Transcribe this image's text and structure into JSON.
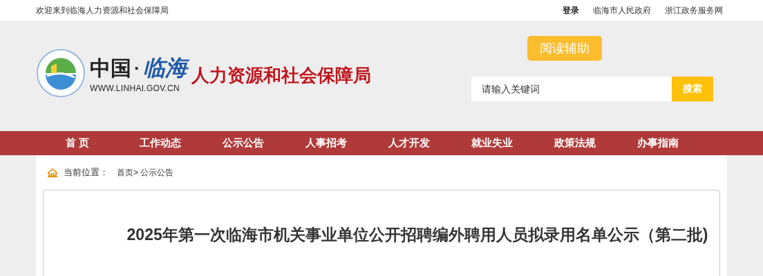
{
  "top_bar": {
    "welcome": "欢迎来到临海人力资源和社会保障局",
    "links": [
      "登录",
      "临海市人民政府",
      "浙江政务服务网"
    ]
  },
  "header": {
    "logo": {
      "china": "中国",
      "dot": "·",
      "linhai": "临海",
      "url": "WWW.LINHAI.GOV.CN",
      "bureau": "人力资源和社会保障局"
    },
    "reading_aid": "阅读辅助",
    "search": {
      "placeholder": "请输入关键词",
      "button": "搜索"
    }
  },
  "nav": [
    "首 页",
    "工作动态",
    "公示公告",
    "人事招考",
    "人才开发",
    "就业失业",
    "政策法规",
    "办事指南"
  ],
  "breadcrumb": {
    "label": "当前位置：",
    "path": "首页> 公示公告"
  },
  "article": {
    "title": "2025年第一次临海市机关事业单位公开招聘编外聘用人员拟录用名单公示（第二批)"
  }
}
